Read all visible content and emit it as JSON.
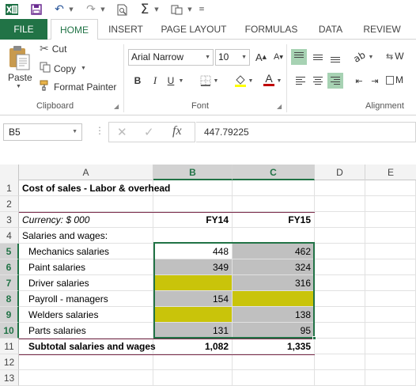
{
  "qat": {
    "app_icon": "excel-logo",
    "icons": [
      "save-icon",
      "undo-icon",
      "redo-icon",
      "print-preview-icon",
      "autosum-icon",
      "paste-special-icon",
      "customize-icon"
    ]
  },
  "tabs": [
    "FILE",
    "HOME",
    "INSERT",
    "PAGE LAYOUT",
    "FORMULAS",
    "DATA",
    "REVIEW"
  ],
  "ribbon": {
    "clipboard": {
      "paste": "Paste",
      "cut": "Cut",
      "copy": "Copy",
      "format_painter": "Format Painter",
      "label": "Clipboard"
    },
    "font": {
      "family": "Arial Narrow",
      "size": "10",
      "grow": "A",
      "shrink": "A",
      "bold": "B",
      "italic": "I",
      "underline": "U",
      "font_color_letter": "A",
      "label": "Font"
    },
    "alignment": {
      "label": "Alignment",
      "wrap_fragment": "W",
      "merge_fragment": "M"
    },
    "colors": {
      "fill_swatch": "#ffff00",
      "font_swatch": "#c00000",
      "accent": "#217346"
    }
  },
  "formula_bar": {
    "name_box": "B5",
    "cancel": "✕",
    "enter": "✓",
    "fx": "fx",
    "value": "447.79225"
  },
  "grid": {
    "columns": [
      "A",
      "B",
      "C",
      "D",
      "E"
    ],
    "rows": [
      {
        "n": "1",
        "a": "Cost of sales - Labor & overhead",
        "b": "",
        "c": ""
      },
      {
        "n": "2",
        "a": "",
        "b": "",
        "c": ""
      },
      {
        "n": "3",
        "a": "Currency: $ 000",
        "b": "FY14",
        "c": "FY15"
      },
      {
        "n": "4",
        "a": "Salaries and wages:",
        "b": "",
        "c": ""
      },
      {
        "n": "5",
        "a": "Mechanics salaries",
        "b": "448",
        "c": "462"
      },
      {
        "n": "6",
        "a": "Paint salaries",
        "b": "349",
        "c": "324"
      },
      {
        "n": "7",
        "a": "Driver salaries",
        "b": "",
        "c": "316"
      },
      {
        "n": "8",
        "a": "Payroll - managers",
        "b": "154",
        "c": ""
      },
      {
        "n": "9",
        "a": "Welders salaries",
        "b": "",
        "c": "138"
      },
      {
        "n": "10",
        "a": "Parts salaries",
        "b": "131",
        "c": "95"
      },
      {
        "n": "11",
        "a": "Subtotal salaries and wages",
        "b": "1,082",
        "c": "1,335"
      },
      {
        "n": "12",
        "a": "",
        "b": "",
        "c": ""
      },
      {
        "n": "13",
        "a": "",
        "b": "",
        "c": ""
      }
    ]
  }
}
